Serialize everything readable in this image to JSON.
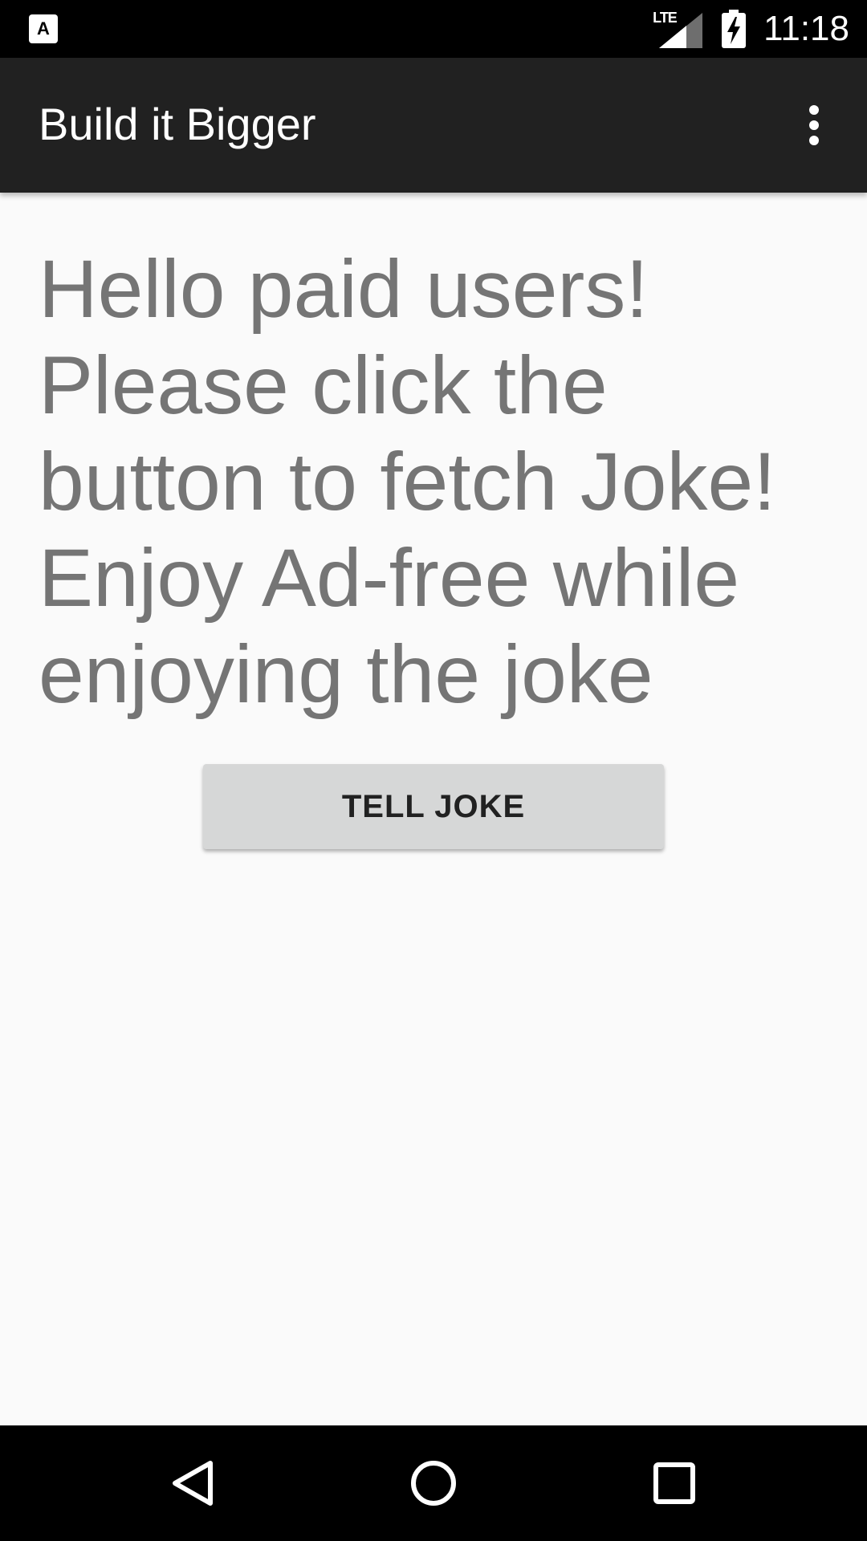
{
  "status_bar": {
    "notification_icon_letter": "A",
    "network_label": "LTE",
    "time": "11:18"
  },
  "app_bar": {
    "title": "Build it Bigger",
    "overflow_icon": "more-vert-icon"
  },
  "main": {
    "message_lines": [
      "Hello paid users!",
      "Please click the",
      "button to fetch Joke!",
      "Enjoy Ad-free while",
      "enjoying the joke"
    ],
    "tell_joke_button_label": "TELL JOKE"
  },
  "nav_bar": {
    "back_icon": "back-triangle-icon",
    "home_icon": "home-circle-icon",
    "recents_icon": "recents-square-icon"
  },
  "colors": {
    "status_bar": "#000000",
    "app_bar": "#212121",
    "background": "#fafafa",
    "message_text": "#757575",
    "button_bg": "#d6d7d7",
    "nav_bar": "#000000"
  }
}
